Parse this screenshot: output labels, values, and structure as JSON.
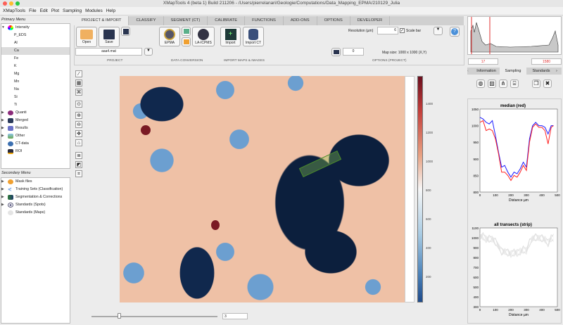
{
  "window": {
    "title": "XMapTools 4 (beta 1) Build 211206 - /Users/pierrelanari/Geologie/Computations/Data_Mapping_EPMA/210129_Julia"
  },
  "menu": [
    "XMapTools",
    "File",
    "Edit",
    "Plot",
    "Sampling",
    "Modules",
    "Help"
  ],
  "primary_menu": {
    "label": "Primary Menu",
    "intensity": "Intensity",
    "elements": [
      "P_EDS",
      "Al",
      "Ca",
      "Fe",
      "K",
      "Mg",
      "Mn",
      "Na",
      "Si",
      "Ti"
    ],
    "selected": "Ca",
    "groups": [
      "Quanti",
      "Merged",
      "Results",
      "Other",
      "CT-data",
      "ROI"
    ]
  },
  "secondary_menu": {
    "label": "Secondary Menu",
    "items": [
      "Mask files",
      "Training Sets (Classification)",
      "Segmentation & Corrections",
      "Standards (Spots)",
      "Standards (Maps)"
    ]
  },
  "tabs": [
    "PROJECT & IMPORT",
    "CLASSIFY",
    "SEGMENT (CT)",
    "CALIBRATE",
    "FUNCTIONS",
    "ADD-ONS",
    "OPTIONS",
    "DEVELOPER"
  ],
  "toolbar": {
    "open": "Open",
    "save": "Save",
    "project_file": "aaa4.mat",
    "project_label": "PROJECT",
    "epma": "EPMA",
    "laicpms": "LA-ICPMS",
    "data_conversion_label": "DATA CONVERSION",
    "import": "Import",
    "import_ct": "Import CT",
    "import_label": "IMPORT MAPS & IMAGES",
    "resolution_label": "Resolution (µm)",
    "resolution": "6",
    "scalebar_label": "Scale bar",
    "scalebar_checked": true,
    "counter": "0",
    "map_size": "Map size: 1000 x 1000 (X,Y)",
    "options_label": "OPTIONS (PROJECT)"
  },
  "colorbar": {
    "ticks": [
      "1400",
      "1200",
      "1000",
      "800",
      "600",
      "400",
      "200"
    ]
  },
  "slider": {
    "value": "3",
    "fraction": 0.22
  },
  "histogram": {
    "min": "17",
    "max": "1580"
  },
  "right_tabs": [
    "Information",
    "Sampling",
    "Standards"
  ],
  "plot1": {
    "title": "median (red)",
    "xlabel": "Distance µm",
    "yticks": [
      "1050",
      "1000",
      "950",
      "900",
      "850",
      "800"
    ],
    "xticks": [
      "0",
      "100",
      "200",
      "300",
      "400",
      "500"
    ]
  },
  "plot2": {
    "title": "all transects (strip)",
    "xlabel": "Distance µm",
    "yticks": [
      "1100",
      "1000",
      "900",
      "800",
      "700",
      "600",
      "500",
      "400",
      "300"
    ],
    "xticks": [
      "0",
      "100",
      "200",
      "300",
      "400",
      "500"
    ]
  },
  "chart_data": [
    {
      "type": "line",
      "title": "median (red)",
      "xlabel": "Distance µm",
      "ylim": [
        800,
        1050
      ],
      "xlim": [
        0,
        500
      ],
      "x": [
        0,
        20,
        40,
        60,
        80,
        100,
        120,
        140,
        160,
        180,
        200,
        220,
        240,
        260,
        280,
        300,
        320,
        340,
        360,
        380,
        400,
        420,
        440,
        460,
        475
      ],
      "series": [
        {
          "name": "blue",
          "color": "#1a1aff",
          "values": [
            1025,
            1020,
            1010,
            1005,
            1015,
            970,
            920,
            875,
            880,
            860,
            845,
            860,
            855,
            870,
            890,
            875,
            960,
            1000,
            1010,
            1000,
            1000,
            995,
            975,
            1000,
            1000
          ]
        },
        {
          "name": "red",
          "color": "#ff2020",
          "values": [
            1010,
            1015,
            985,
            990,
            985,
            960,
            915,
            860,
            860,
            850,
            835,
            850,
            845,
            860,
            880,
            865,
            950,
            995,
            1005,
            995,
            995,
            985,
            945,
            995,
            1000
          ]
        }
      ]
    }
  ]
}
